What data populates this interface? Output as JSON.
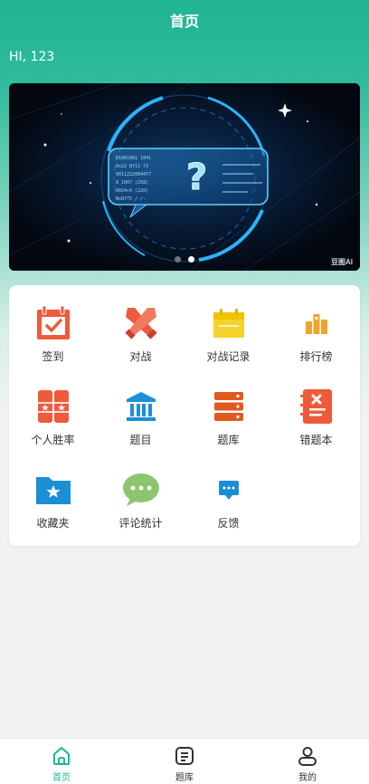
{
  "header": {
    "title": "首页"
  },
  "greeting": "HI, 123",
  "banner": {
    "watermark": "豆图AI",
    "slide_count": 2,
    "active_slide": 2
  },
  "grid": [
    {
      "label": "签到",
      "icon": "calendar-check-icon",
      "color": "#ee5a3c"
    },
    {
      "label": "对战",
      "icon": "crossed-swords-icon",
      "color": "#ee5a3c"
    },
    {
      "label": "对战记录",
      "icon": "calendar-icon",
      "color": "#f6d32a"
    },
    {
      "label": "排行榜",
      "icon": "bar-chart-icon",
      "color": "#f2a32a"
    },
    {
      "label": "个人胜率",
      "icon": "cards-icon",
      "color": "#ee5a3c"
    },
    {
      "label": "题目",
      "icon": "bank-icon",
      "color": "#1d8fd8"
    },
    {
      "label": "题库",
      "icon": "database-icon",
      "color": "#e0591f"
    },
    {
      "label": "错题本",
      "icon": "notebook-x-icon",
      "color": "#ee5a3c"
    },
    {
      "label": "收藏夹",
      "icon": "folder-star-icon",
      "color": "#1a8fd4"
    },
    {
      "label": "评论统计",
      "icon": "chat-bubble-icon",
      "color": "#8dc56e"
    },
    {
      "label": "反馈",
      "icon": "message-icon",
      "color": "#1a8fd4"
    }
  ],
  "tabbar": [
    {
      "label": "首页",
      "icon": "home-icon",
      "active": true
    },
    {
      "label": "题库",
      "icon": "list-icon",
      "active": false
    },
    {
      "label": "我的",
      "icon": "user-icon",
      "active": false
    }
  ],
  "colors": {
    "primary": "#1fb493"
  }
}
